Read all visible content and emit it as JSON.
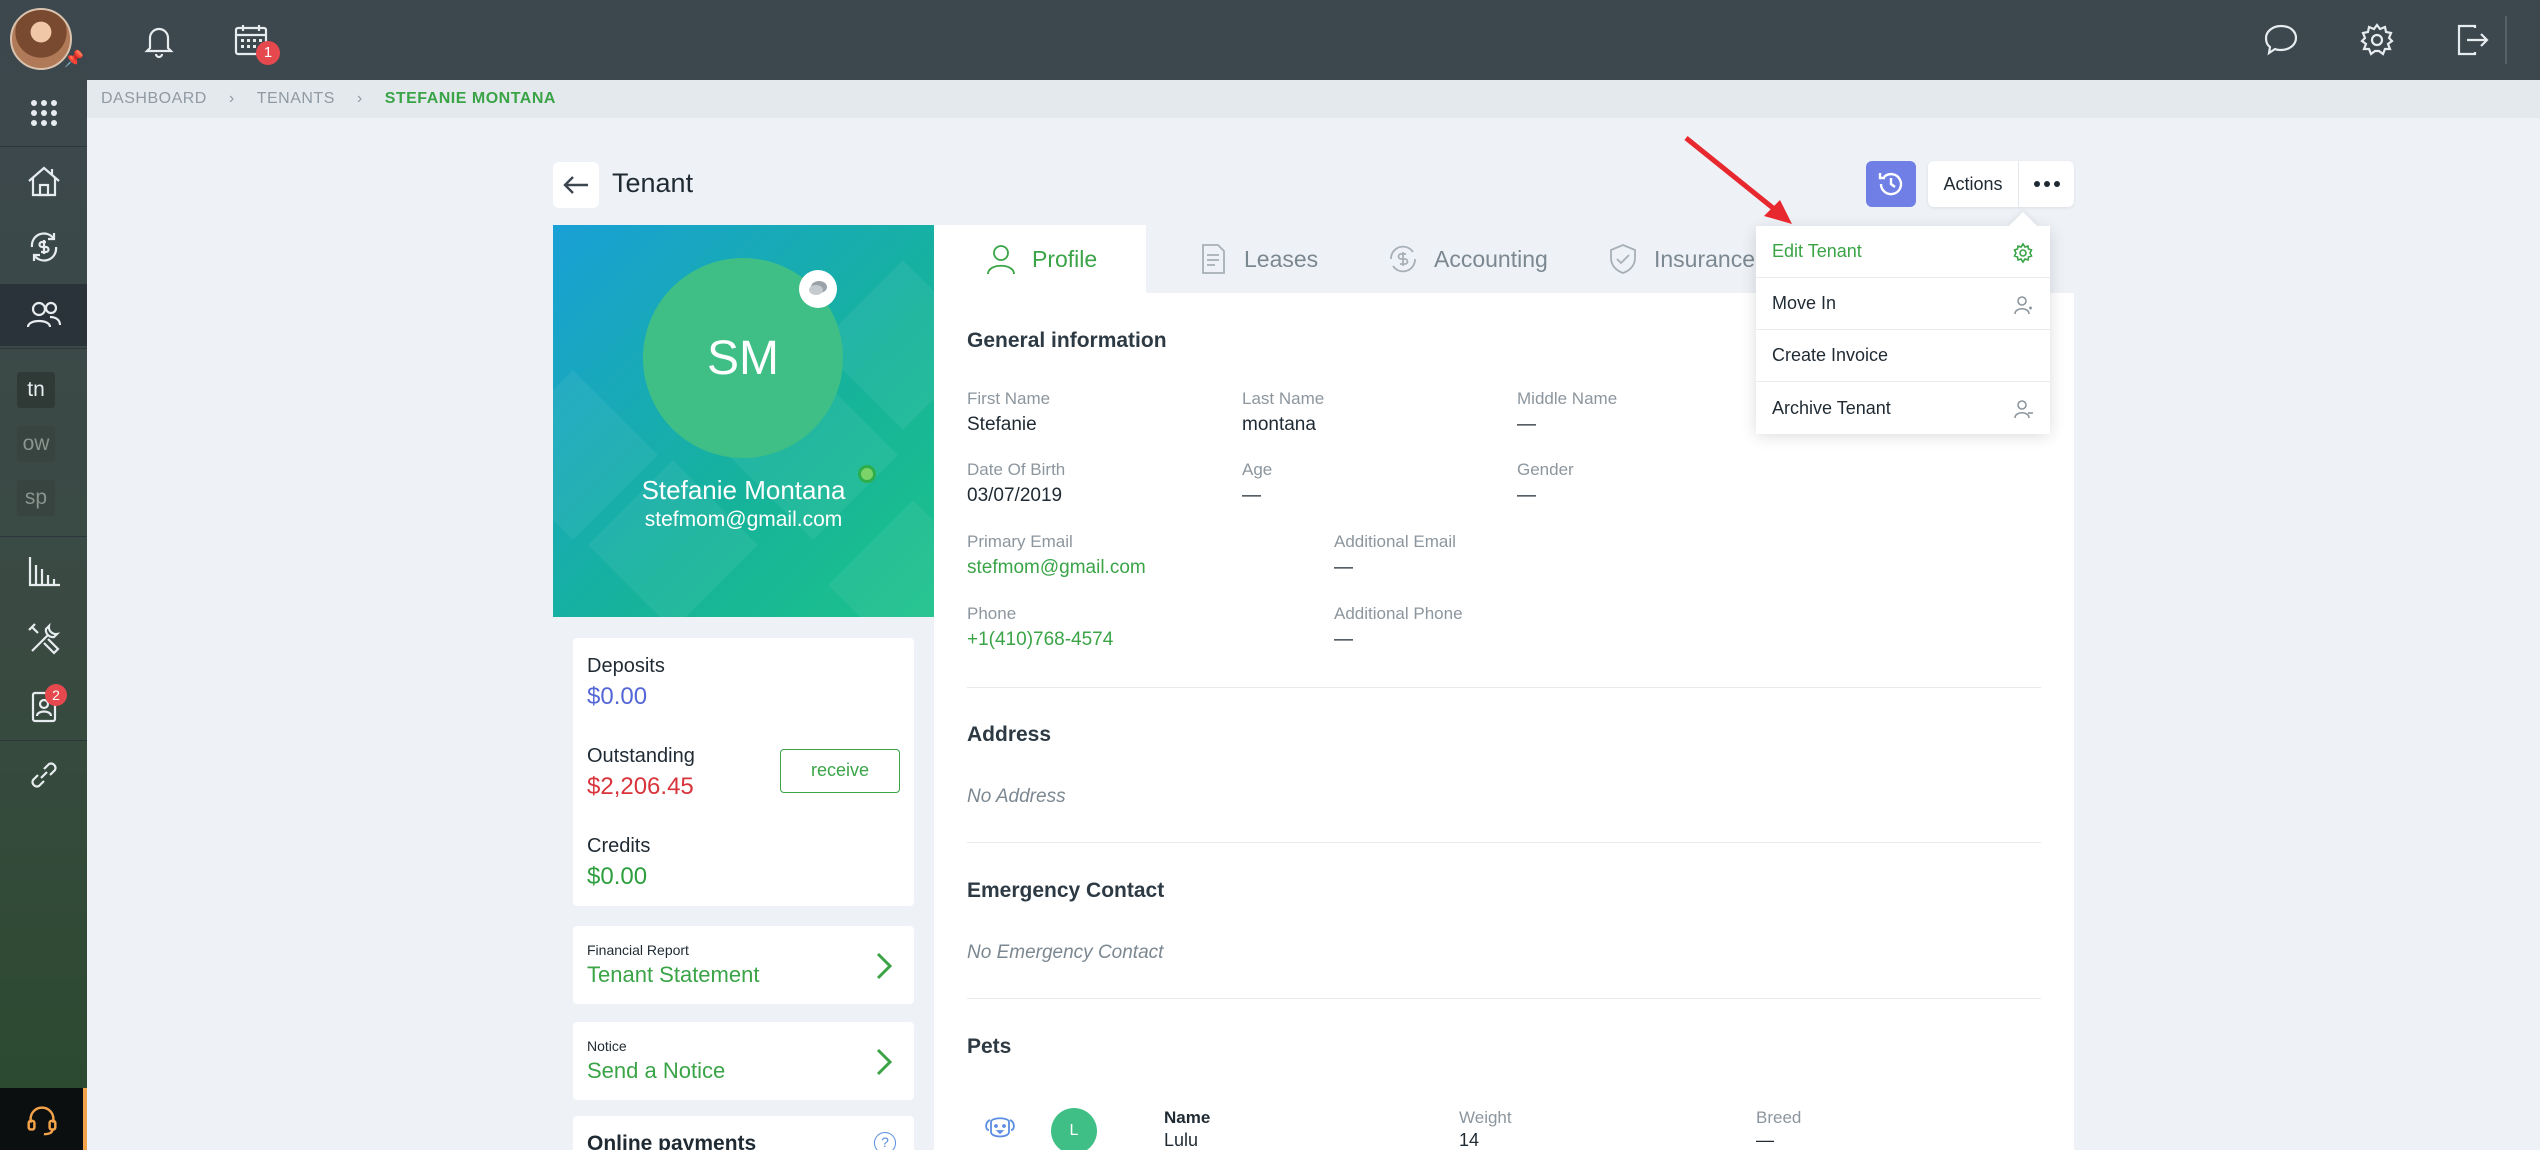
{
  "breadcrumb": {
    "items": [
      "DASHBOARD",
      "TENANTS",
      "STEFANIE MONTANA"
    ]
  },
  "topbar": {
    "calendar_badge": "1"
  },
  "sidebar": {
    "tags": [
      "tn",
      "ow",
      "sp"
    ],
    "contacts_badge": "2",
    "icons": [
      "apps-grid-icon",
      "home-icon",
      "money-cycle-icon",
      "people-icon",
      "chart-icon",
      "tools-icon",
      "contact-card-icon",
      "link-icon",
      "headset-icon"
    ]
  },
  "header": {
    "title": "Tenant",
    "actions_label": "Actions"
  },
  "actions_menu": {
    "items": [
      {
        "label": "Edit Tenant",
        "icon": "gear-icon"
      },
      {
        "label": "Move In",
        "icon": "user-icon"
      },
      {
        "label": "Create Invoice"
      },
      {
        "label": "Archive Tenant",
        "icon": "user-icon"
      }
    ]
  },
  "profile": {
    "initials": "SM",
    "name": "Stefanie Montana",
    "email": "stefmom@gmail.com"
  },
  "balances": {
    "deposits_label": "Deposits",
    "deposits_value": "$0.00",
    "outstanding_label": "Outstanding",
    "outstanding_value": "$2,206.45",
    "credits_label": "Credits",
    "credits_value": "$0.00",
    "receive_label": "receive",
    "colors": {
      "deposits": "#5567d6",
      "outstanding": "#d8343c",
      "credits": "#2e9e3e"
    }
  },
  "links": [
    {
      "small": "Financial Report",
      "big": "Tenant Statement"
    },
    {
      "small": "Notice",
      "big": "Send a Notice"
    }
  ],
  "online_payments": {
    "title": "Online payments",
    "help": "?"
  },
  "tabs": [
    {
      "label": "Profile",
      "icon": "person-icon"
    },
    {
      "label": "Leases",
      "icon": "document-icon"
    },
    {
      "label": "Accounting",
      "icon": "dollar-cycle-icon"
    },
    {
      "label": "Insurance",
      "icon": "shield-icon"
    }
  ],
  "general": {
    "title": "General information",
    "first_name_label": "First Name",
    "first_name": "Stefanie",
    "last_name_label": "Last Name",
    "last_name": "montana",
    "middle_name_label": "Middle Name",
    "middle_name": "—",
    "dob_label": "Date Of Birth",
    "dob": "03/07/2019",
    "age_label": "Age",
    "age": "—",
    "gender_label": "Gender",
    "gender": "—",
    "primary_email_label": "Primary Email",
    "primary_email": "stefmom@gmail.com",
    "additional_email_label": "Additional Email",
    "additional_email": "—",
    "phone_label": "Phone",
    "phone": "+1(410)768-4574",
    "additional_phone_label": "Additional Phone",
    "additional_phone": "—"
  },
  "address": {
    "title": "Address",
    "empty": "No Address"
  },
  "emergency": {
    "title": "Emergency Contact",
    "empty": "No Emergency Contact"
  },
  "pets": {
    "title": "Pets",
    "name_label": "Name",
    "weight_label": "Weight",
    "breed_label": "Breed",
    "items": [
      {
        "initial": "L",
        "name": "Lulu",
        "weight": "14",
        "breed": "—"
      }
    ]
  },
  "accent_color": "#3aa447"
}
